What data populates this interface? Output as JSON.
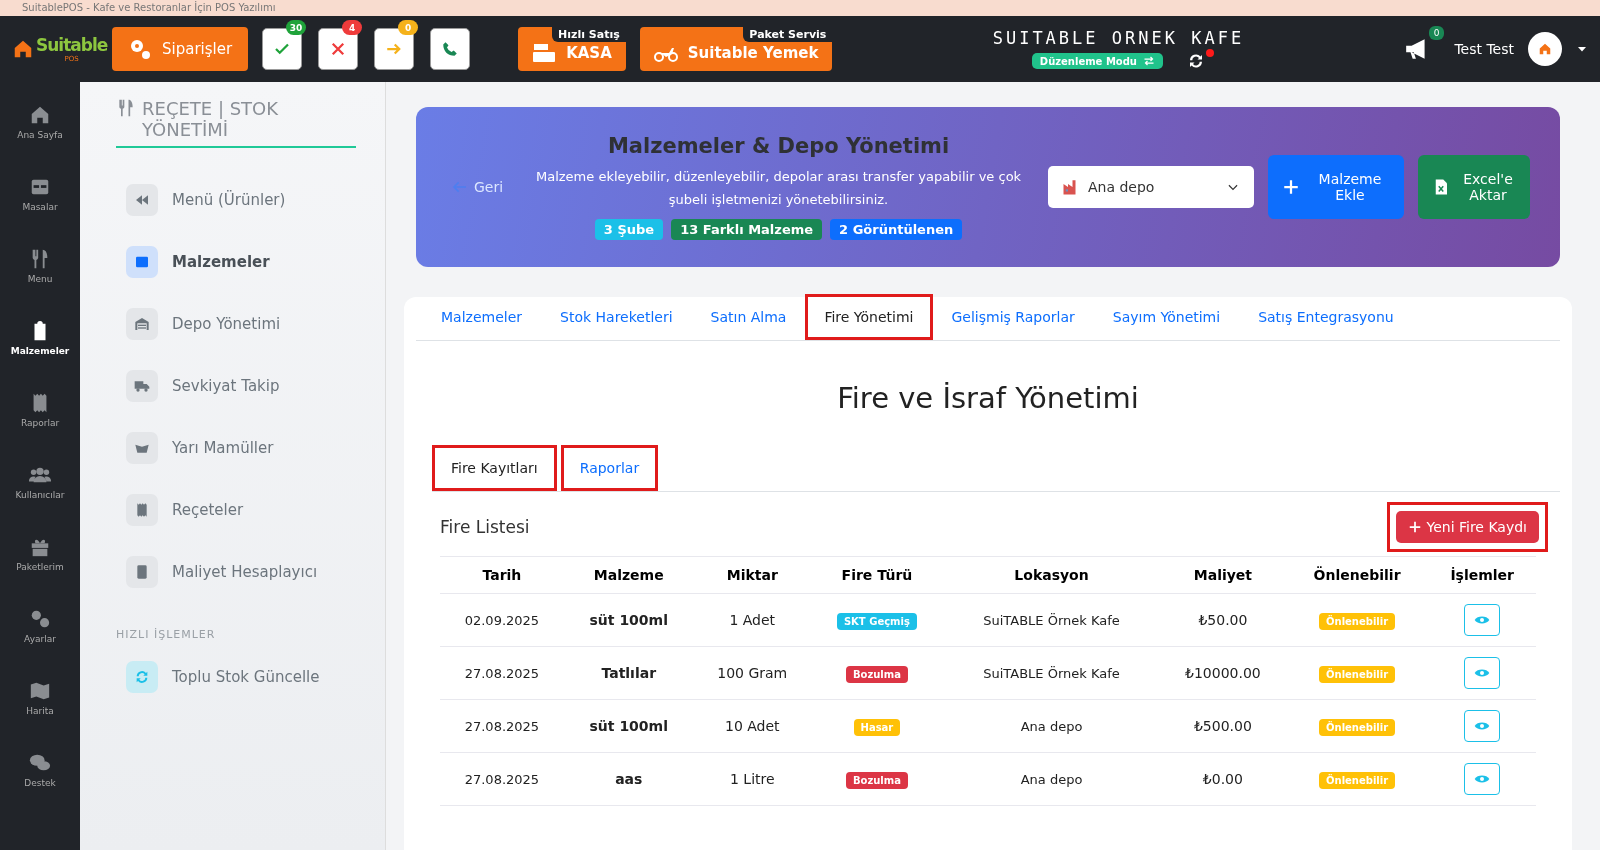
{
  "window": {
    "title": "SuitablePOS - Kafe ve Restoranlar İçin POS Yazılımı"
  },
  "header": {
    "logo": {
      "name": "Suitable",
      "sub": "POS"
    },
    "orders_button": "Siparişler",
    "status_buttons": [
      {
        "kind": "check",
        "count": "30",
        "color": "#1fa33a"
      },
      {
        "kind": "cross",
        "count": "4",
        "color": "#ef3b3b"
      },
      {
        "kind": "arrow",
        "count": "0",
        "color": "#f5b21b"
      },
      {
        "kind": "phone"
      }
    ],
    "quick_buttons": [
      {
        "kind": "register",
        "tag": "Hızlı Satış",
        "label": "KASA"
      },
      {
        "kind": "moto",
        "tag": "Paket Servis",
        "label": "Suitable Yemek"
      }
    ],
    "venue": "SUITABLE ORNEK KAFE",
    "mode_badge": "Düzenleme Modu",
    "notifications": "0",
    "user": "Test Test"
  },
  "nav": [
    {
      "label": "Ana Sayfa",
      "selected": false
    },
    {
      "label": "Masalar",
      "selected": false
    },
    {
      "label": "Menu",
      "selected": false
    },
    {
      "label": "Malzemeler",
      "selected": true
    },
    {
      "label": "Raporlar",
      "selected": false
    },
    {
      "label": "Kullanıcılar",
      "selected": false
    },
    {
      "label": "Paketlerim",
      "selected": false
    },
    {
      "label": "Ayarlar",
      "selected": false
    },
    {
      "label": "Harita",
      "selected": false
    },
    {
      "label": "Destek",
      "selected": false
    }
  ],
  "sidebar": {
    "title": "REÇETE | STOK YÖNETİMİ",
    "items": [
      {
        "label": "Menü (Ürünler)",
        "selected": false
      },
      {
        "label": "Malzemeler",
        "selected": true
      },
      {
        "label": "Depo Yönetimi",
        "selected": false
      },
      {
        "label": "Sevkiyat Takip",
        "selected": false
      },
      {
        "label": "Yarı Mamüller",
        "selected": false
      },
      {
        "label": "Reçeteler",
        "selected": false
      },
      {
        "label": "Maliyet Hesaplayıcı",
        "selected": false
      }
    ],
    "section": "HIZLI İŞLEMLER",
    "quick_items": [
      {
        "label": "Toplu Stok Güncelle"
      }
    ]
  },
  "banner": {
    "back": "Geri",
    "title": "Malzemeler & Depo Yönetimi",
    "description": "Malzeme ekleyebilir, düzenleyebilir, depolar arası transfer yapabilir ve çok şubeli işletmenizi yönetebilirsiniz.",
    "badges": [
      {
        "label": "3 Şube",
        "color": "#1bc0e8"
      },
      {
        "label": "13 Farklı Malzeme",
        "color": "#198754"
      },
      {
        "label": "2 Görüntülenen",
        "color": "#0d6efd"
      }
    ],
    "depot_select": "Ana depo",
    "add_button": "Malzeme Ekle",
    "export_button": "Excel'e Aktar"
  },
  "tabs": [
    {
      "label": "Malzemeler",
      "selected": false,
      "highlighted": false
    },
    {
      "label": "Stok Hareketleri",
      "selected": false,
      "highlighted": false
    },
    {
      "label": "Satın Alma",
      "selected": false,
      "highlighted": false
    },
    {
      "label": "Fire Yönetimi",
      "selected": true,
      "highlighted": true
    },
    {
      "label": "Gelişmiş Raporlar",
      "selected": false,
      "highlighted": false
    },
    {
      "label": "Sayım Yönetimi",
      "selected": false,
      "highlighted": false
    },
    {
      "label": "Satış Entegrasyonu",
      "selected": false,
      "highlighted": false
    }
  ],
  "section_title": "Fire ve İsraf Yönetimi",
  "subtabs": [
    {
      "label": "Fire Kayıtları",
      "selected": true,
      "highlighted": true
    },
    {
      "label": "Raporlar",
      "selected": false,
      "highlighted": true
    }
  ],
  "list_title": "Fire Listesi",
  "new_button": {
    "label": "Yeni Fire Kaydı",
    "highlighted": true
  },
  "table": {
    "columns": [
      "Tarih",
      "Malzeme",
      "Miktar",
      "Fire Türü",
      "Lokasyon",
      "Maliyet",
      "Önlenebilir",
      "İşlemler"
    ],
    "rows": [
      {
        "date": "02.09.2025",
        "item": "süt 100ml",
        "qty": "1 Adet",
        "type": {
          "label": "SKT Geçmiş",
          "color": "#1bc0e8"
        },
        "location": "SuiTABLE Örnek Kafe",
        "cost": "₺50.00",
        "preventable": "Önlenebilir"
      },
      {
        "date": "27.08.2025",
        "item": "Tatlılar",
        "qty": "100 Gram",
        "type": {
          "label": "Bozulma",
          "color": "#dc3545"
        },
        "location": "SuiTABLE Örnek Kafe",
        "cost": "₺10000.00",
        "preventable": "Önlenebilir"
      },
      {
        "date": "27.08.2025",
        "item": "süt 100ml",
        "qty": "10 Adet",
        "type": {
          "label": "Hasar",
          "color": "#ffc107"
        },
        "location": "Ana depo",
        "cost": "₺500.00",
        "preventable": "Önlenebilir"
      },
      {
        "date": "27.08.2025",
        "item": "aas",
        "qty": "1 Litre",
        "type": {
          "label": "Bozulma",
          "color": "#dc3545"
        },
        "location": "Ana depo",
        "cost": "₺0.00",
        "preventable": "Önlenebilir"
      }
    ]
  }
}
